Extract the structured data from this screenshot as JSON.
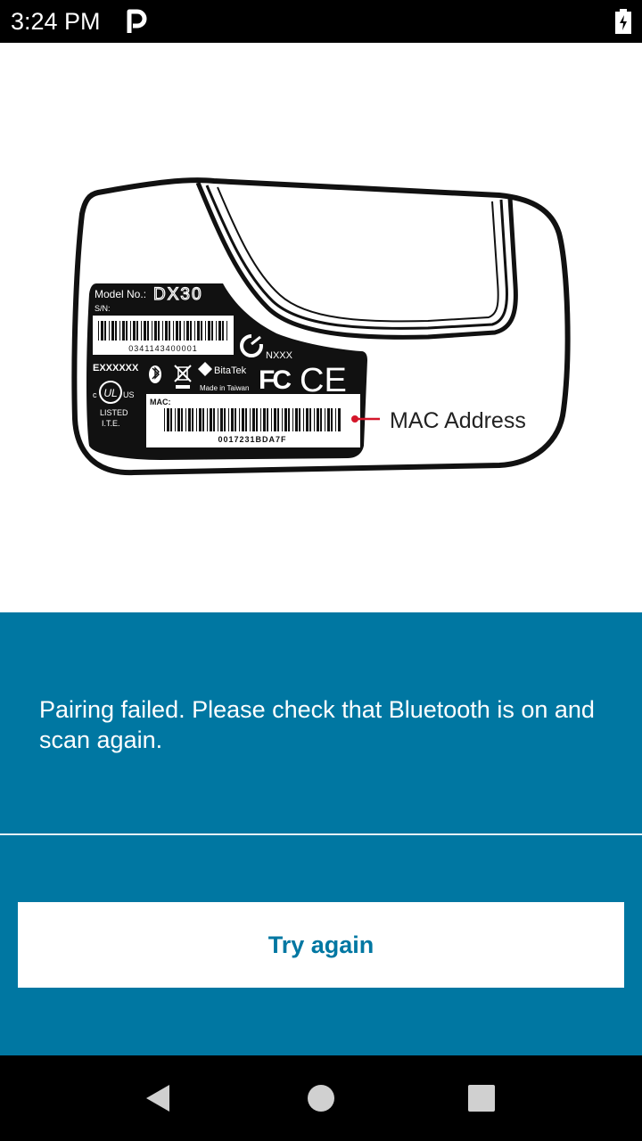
{
  "status_bar": {
    "time": "3:24 PM",
    "app_icon": "parking-p-icon",
    "battery_icon": "battery-charging-icon"
  },
  "illustration": {
    "model_label": "Model No.:",
    "model_number": "DX30",
    "sn_label": "S/N:",
    "sn_value": "0341143400001",
    "cert_id": "EXXXXXX",
    "brand": "BitaTek",
    "made_in": "Made in Taiwan",
    "c_tick_code": "NXXX",
    "listed_line1": "LISTED",
    "listed_line2": "I.T.E.",
    "ul_mark_left": "c",
    "ul_mark_center": "UL",
    "ul_mark_right": "US",
    "fcc_mark": "FC",
    "ce_mark": "CE",
    "mac_label": "MAC:",
    "mac_value": "0017231BDA7F",
    "callout_label": "MAC Address"
  },
  "panel": {
    "message": "Pairing failed. Please check that Bluetooth is on and scan again.",
    "button_label": "Try again"
  },
  "nav_bar": {
    "back_icon": "back-triangle-icon",
    "home_icon": "home-circle-icon",
    "recents_icon": "recents-square-icon"
  },
  "colors": {
    "panel_background": "#0077a2",
    "button_text": "#0077a2",
    "callout_dot": "#d4162a"
  }
}
